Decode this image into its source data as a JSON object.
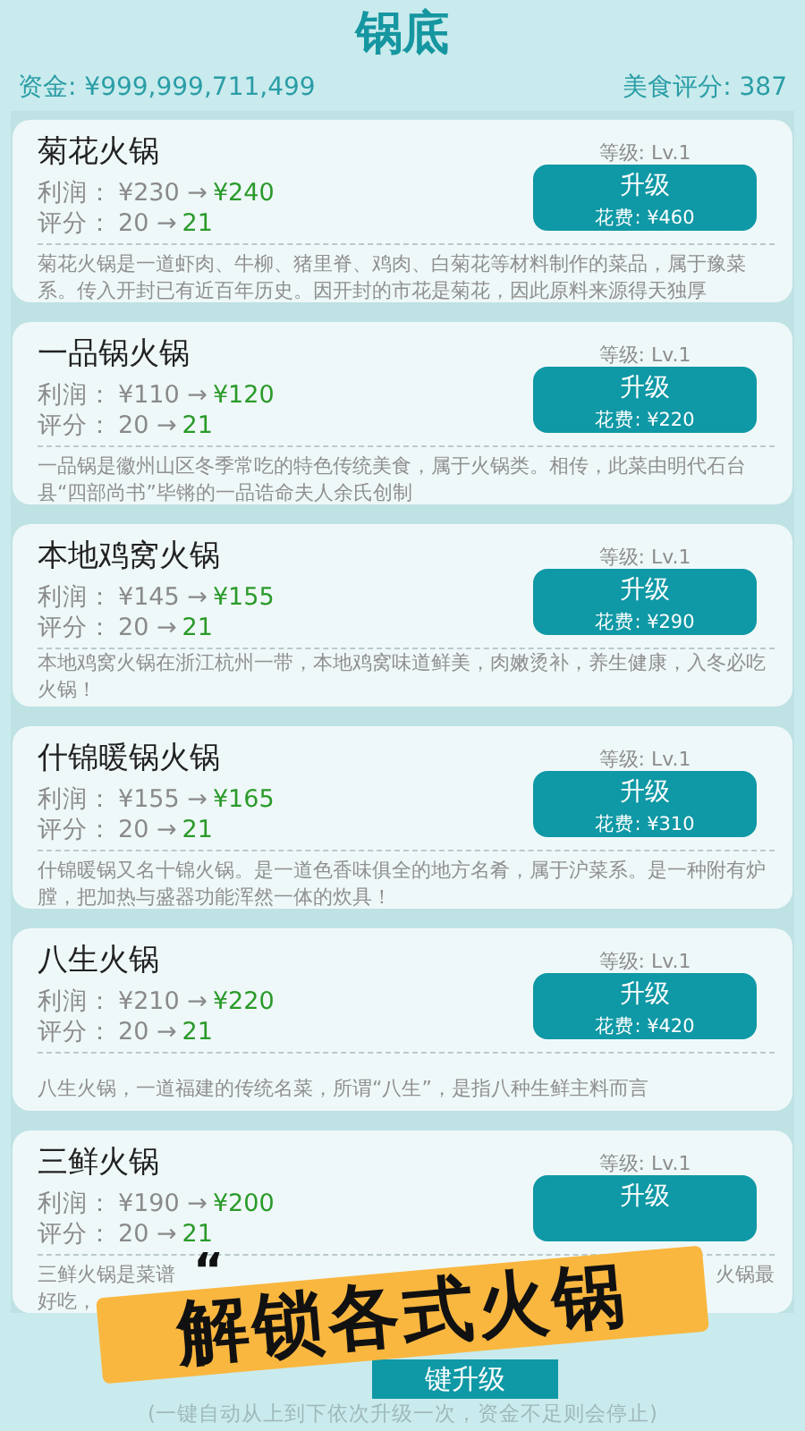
{
  "title": "锅底",
  "header": {
    "funds": "资金: ¥999,999,711,499",
    "rating": "美食评分: 387"
  },
  "dishes": [
    {
      "name": "菊花火锅",
      "level": "等级: Lv.1",
      "profit_label": "利润：",
      "profit_from": "¥230 →",
      "profit_to": "¥240",
      "score_label": "评分：",
      "score_from": "20 →",
      "score_to": "21",
      "button": "升级",
      "cost": "花费: ¥460",
      "desc": "菊花火锅是一道虾肉、牛柳、猪里脊、鸡肉、白菊花等材料制作的菜品，属于豫菜系。传入开封已有近百年历史。因开封的市花是菊花，因此原料来源得天独厚"
    },
    {
      "name": "一品锅火锅",
      "level": "等级: Lv.1",
      "profit_label": "利润：",
      "profit_from": "¥110 →",
      "profit_to": "¥120",
      "score_label": "评分：",
      "score_from": "20 →",
      "score_to": "21",
      "button": "升级",
      "cost": "花费: ¥220",
      "desc": "一品锅是徽州山区冬季常吃的特色传统美食，属于火锅类。相传，此菜由明代石台县“四部尚书”毕锵的一品诰命夫人余氏创制"
    },
    {
      "name": "本地鸡窝火锅",
      "level": "等级: Lv.1",
      "profit_label": "利润：",
      "profit_from": "¥145 →",
      "profit_to": "¥155",
      "score_label": "评分：",
      "score_from": "20 →",
      "score_to": "21",
      "button": "升级",
      "cost": "花费: ¥290",
      "desc": "本地鸡窝火锅在浙江杭州一带，本地鸡窝味道鲜美，肉嫩烫补，养生健康，入冬必吃火锅！"
    },
    {
      "name": "什锦暖锅火锅",
      "level": "等级: Lv.1",
      "profit_label": "利润：",
      "profit_from": "¥155 →",
      "profit_to": "¥165",
      "score_label": "评分：",
      "score_from": "20 →",
      "score_to": "21",
      "button": "升级",
      "cost": "花费: ¥310",
      "desc": "什锦暖锅又名十锦火锅。是一道色香味俱全的地方名肴，属于沪菜系。是一种附有炉膛，把加热与盛器功能浑然一体的炊具！"
    },
    {
      "name": "八生火锅",
      "level": "等级: Lv.1",
      "profit_label": "利润：",
      "profit_from": "¥210 →",
      "profit_to": "¥220",
      "score_label": "评分：",
      "score_from": "20 →",
      "score_to": "21",
      "button": "升级",
      "cost": "花费: ¥420",
      "desc": "八生火锅，一道福建的传统名菜，所谓“八生”，是指八种生鲜主料而言"
    },
    {
      "name": "三鲜火锅",
      "level": "等级: Lv.1",
      "profit_label": "利润：",
      "profit_from": "¥190 →",
      "profit_to": "¥200",
      "score_label": "评分：",
      "score_from": "20 →",
      "score_to": "21",
      "button": "升级",
      "desc_lines": [
        [
          "三鲜火锅是菜谱",
          "火锅最"
        ],
        [
          "好吃，"
        ]
      ]
    }
  ],
  "upgrade_all": {
    "label": "键升级",
    "note": "(一键自动从上到下依次升级一次，资金不足则会停止)"
  },
  "banner": {
    "quote": "“",
    "text": "解锁各式火锅"
  }
}
